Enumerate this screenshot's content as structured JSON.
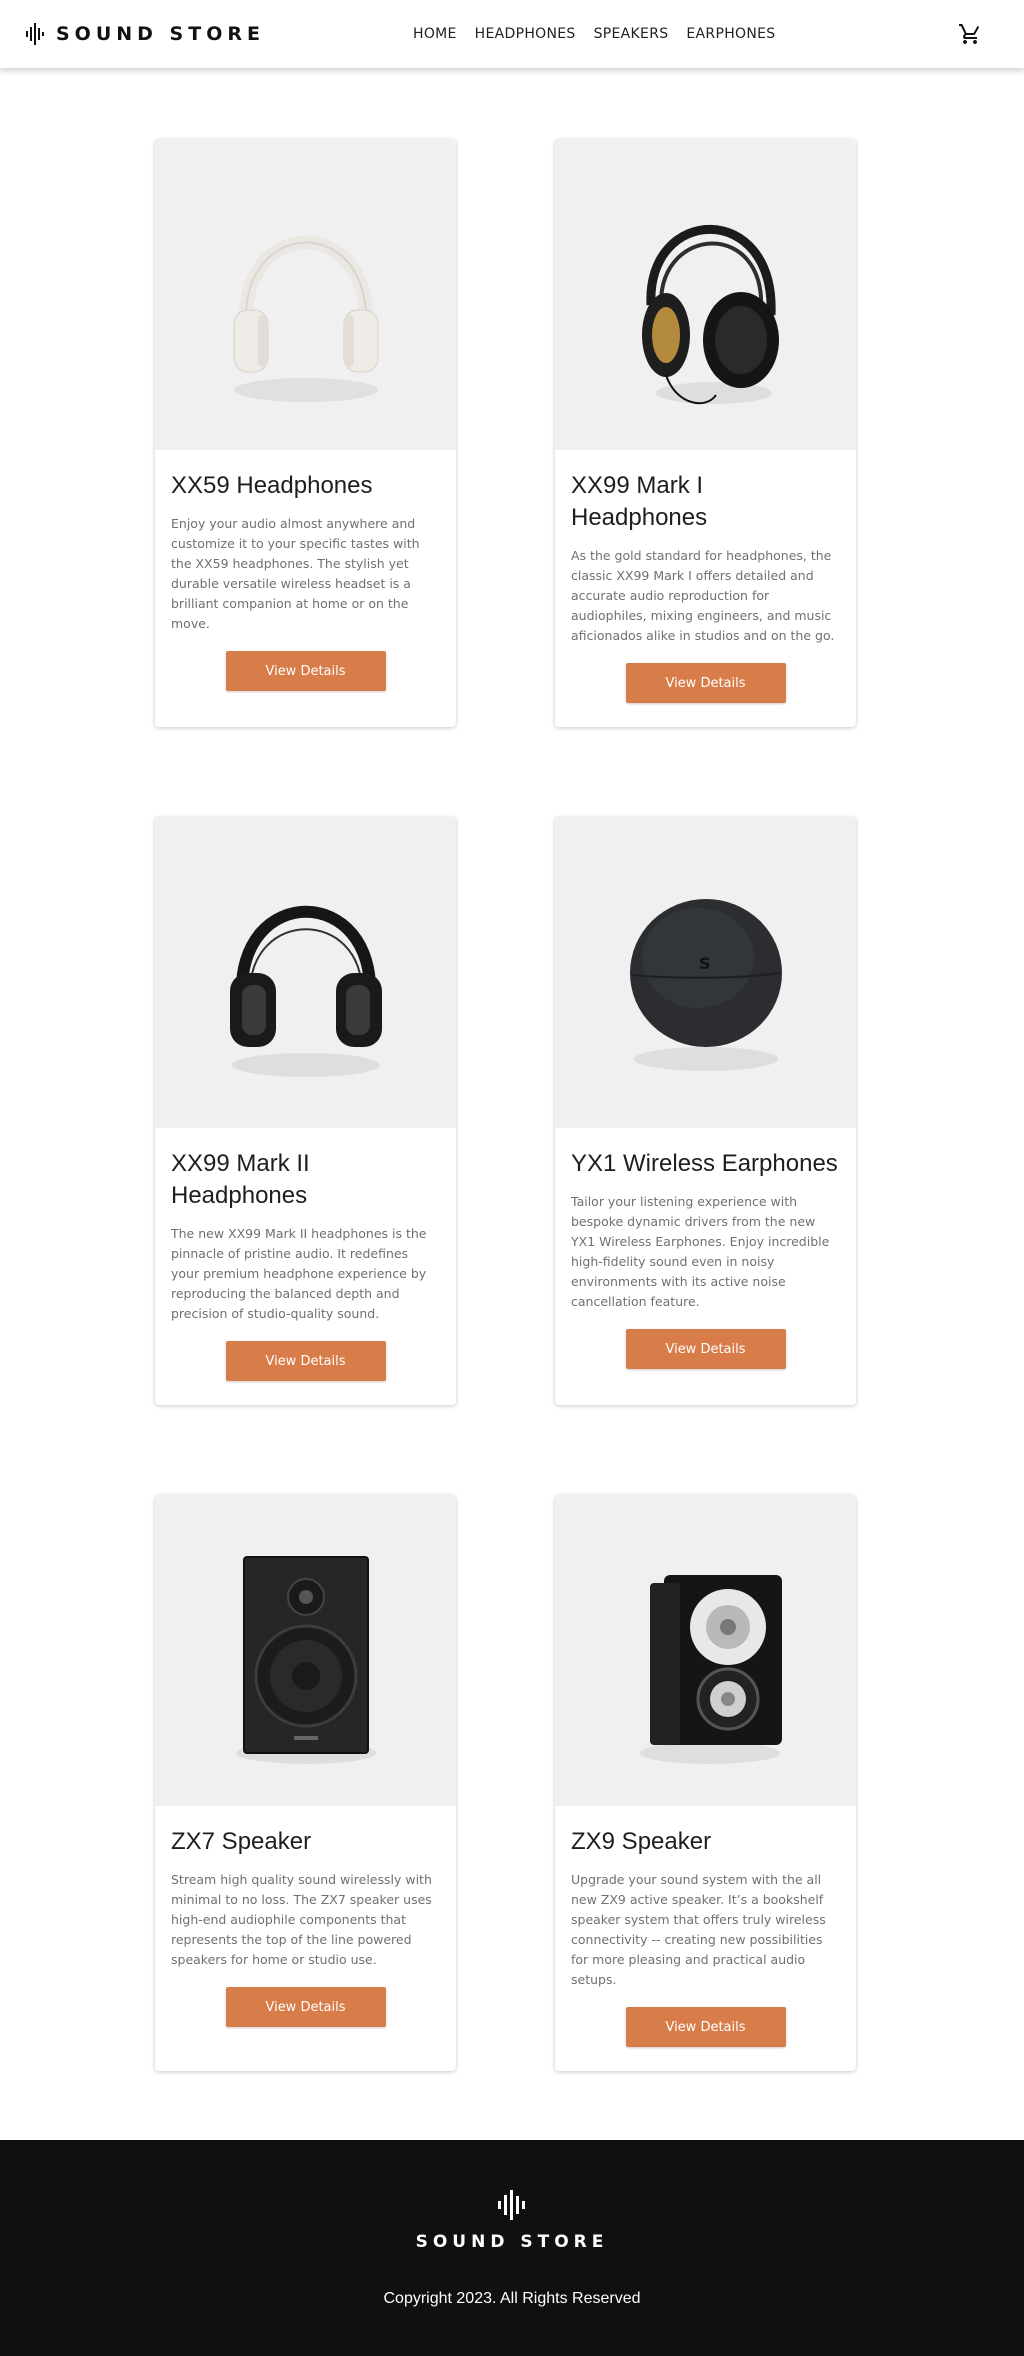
{
  "header": {
    "brand": "SOUND STORE",
    "nav": [
      "HOME",
      "HEADPHONES",
      "SPEAKERS",
      "EARPHONES"
    ],
    "cart_icon": "cart-icon"
  },
  "products": [
    {
      "title": "XX59 Headphones",
      "description": "Enjoy your audio almost anywhere and customize it to your specific tastes with the XX59 headphones. The stylish yet durable versatile wireless headset is a brilliant companion at home or on the move.",
      "button": "View Details",
      "image": "white-headphones"
    },
    {
      "title": "XX99 Mark I Headphones",
      "description": "As the gold standard for headphones, the classic XX99 Mark I offers detailed and accurate audio reproduction for audiophiles, mixing engineers, and music aficionados alike in studios and on the go.",
      "button": "View Details",
      "image": "black-gold-headphones"
    },
    {
      "title": "XX99 Mark II Headphones",
      "description": "The new XX99 Mark II headphones is the pinnacle of pristine audio. It redefines your premium headphone experience by reproducing the balanced depth and precision of studio-quality sound.",
      "button": "View Details",
      "image": "black-headphones"
    },
    {
      "title": "YX1 Wireless Earphones",
      "description": "Tailor your listening experience with bespoke dynamic drivers from the new YX1 Wireless Earphones. Enjoy incredible high-fidelity sound even in noisy environments with its active noise cancellation feature.",
      "button": "View Details",
      "image": "earphones-case"
    },
    {
      "title": "ZX7 Speaker",
      "description": "Stream high quality sound wirelessly with minimal to no loss. The ZX7 speaker uses high-end audiophile components that represents the top of the line powered speakers for home or studio use.",
      "button": "View Details",
      "image": "zx7-speaker"
    },
    {
      "title": "ZX9 Speaker",
      "description": "Upgrade your sound system with the all new ZX9 active speaker. It’s a bookshelf speaker system that offers truly wireless connectivity -- creating new possibilities for more pleasing and practical audio setups.",
      "button": "View Details",
      "image": "zx9-speaker"
    }
  ],
  "footer": {
    "brand": "SOUND STORE",
    "copyright": "Copyright 2023. All Rights Reserved"
  },
  "colors": {
    "accent": "#d87d4a",
    "footer_bg": "#101010",
    "media_bg": "#f0f0f0"
  }
}
